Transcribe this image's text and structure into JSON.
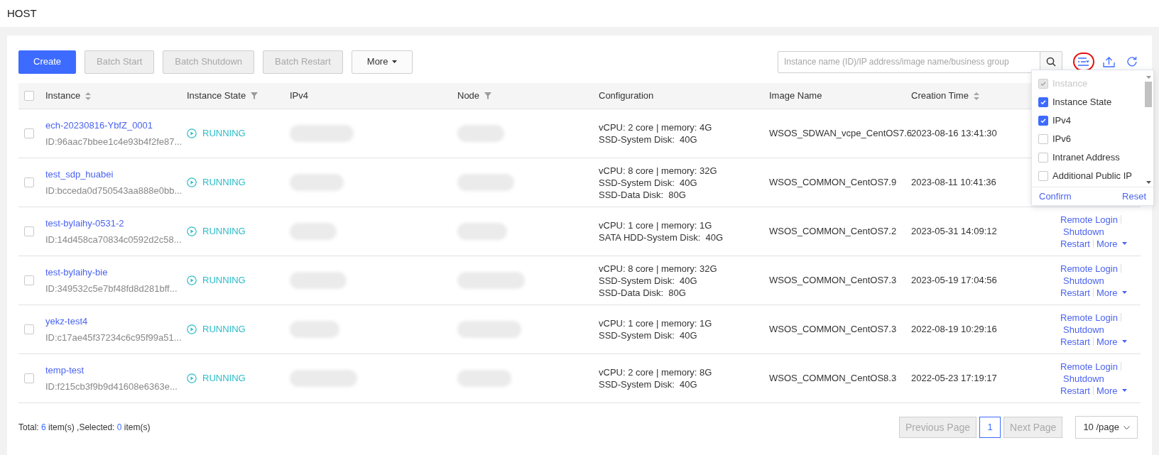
{
  "page_title": "HOST",
  "toolbar": [
    {
      "label": "Create",
      "kind": "primary"
    },
    {
      "label": "Batch Start",
      "kind": "disabled"
    },
    {
      "label": "Batch Shutdown",
      "kind": "disabled"
    },
    {
      "label": "Batch Restart",
      "kind": "disabled"
    },
    {
      "label": "More",
      "kind": "dropdown"
    }
  ],
  "search": {
    "placeholder": "Instance name (ID)/IP address/image name/business group"
  },
  "table": {
    "select_all_checked": false,
    "columns": [
      {
        "label": "Instance",
        "kind": "sort"
      },
      {
        "label": "Instance State",
        "kind": "filter"
      },
      {
        "label": "IPv4",
        "kind": "plain"
      },
      {
        "label": "Node",
        "kind": "filter"
      },
      {
        "label": "Configuration",
        "kind": "plain"
      },
      {
        "label": "Image Name",
        "kind": "plain"
      },
      {
        "label": "Creation Time",
        "kind": "sort"
      }
    ],
    "rows": [
      {
        "checked": false,
        "name": "ech-20230816-YbfZ_0001",
        "id": "ID:96aac7bbee1c4e93b4f2fe87...",
        "state": "RUNNING",
        "configuration": [
          "vCPU: 2 core | memory: 4G",
          "SSD-System Disk:  40G"
        ],
        "image": "WSOS_SDWAN_vcpe_CentOS7.6",
        "created": "2023-08-16 13:41:30"
      },
      {
        "checked": false,
        "name": "test_sdp_huabei",
        "id": "ID:bcceda0d750543aa888e0bb...",
        "state": "RUNNING",
        "configuration": [
          "vCPU: 8 core | memory: 32G",
          "SSD-System Disk:  40G",
          "SSD-Data Disk:  80G"
        ],
        "image": "WSOS_COMMON_CentOS7.9",
        "created": "2023-08-11 10:41:36"
      },
      {
        "checked": false,
        "name": "test-bylaihy-0531-2",
        "id": "ID:14d458ca70834c0592d2c58...",
        "state": "RUNNING",
        "configuration": [
          "vCPU: 1 core | memory: 1G",
          "SATA HDD-System Disk:  40G"
        ],
        "image": "WSOS_COMMON_CentOS7.2",
        "created": "2023-05-31 14:09:12",
        "actions": [
          "Remote Login",
          "Shutdown",
          "Restart",
          "More"
        ]
      },
      {
        "checked": false,
        "name": "test-bylaihy-bie",
        "id": "ID:349532c5e7bf48fd8d281bff...",
        "state": "RUNNING",
        "configuration": [
          "vCPU: 8 core | memory: 32G",
          "SSD-System Disk:  40G",
          "SSD-Data Disk:  80G"
        ],
        "image": "WSOS_COMMON_CentOS7.3",
        "created": "2023-05-19 17:04:56",
        "actions": [
          "Remote Login",
          "Shutdown",
          "Restart",
          "More"
        ]
      },
      {
        "checked": false,
        "name": "yekz-test4",
        "id": "ID:c17ae45f37234c6c95f99a51...",
        "state": "RUNNING",
        "configuration": [
          "vCPU: 1 core | memory: 1G",
          "SSD-System Disk:  40G"
        ],
        "image": "WSOS_COMMON_CentOS7.3",
        "created": "2022-08-19 10:29:16",
        "actions": [
          "Remote Login",
          "Shutdown",
          "Restart",
          "More"
        ]
      },
      {
        "checked": false,
        "name": "temp-test",
        "id": "ID:f215cb3f9b9d41608e6363e...",
        "state": "RUNNING",
        "configuration": [
          "vCPU: 2 core | memory: 8G",
          "SSD-System Disk:  40G"
        ],
        "image": "WSOS_COMMON_CentOS8.3",
        "created": "2022-05-23 17:19:17",
        "actions": [
          "Remote Login",
          "Shutdown",
          "Restart",
          "More"
        ]
      }
    ]
  },
  "column_picker": {
    "items": [
      {
        "label": "Instance",
        "checked": true,
        "disabled": true
      },
      {
        "label": "Instance State",
        "checked": true,
        "disabled": false
      },
      {
        "label": "IPv4",
        "checked": true,
        "disabled": false
      },
      {
        "label": "IPv6",
        "checked": false,
        "disabled": false
      },
      {
        "label": "Intranet Address",
        "checked": false,
        "disabled": false
      },
      {
        "label": "Additional Public IP",
        "checked": false,
        "disabled": false
      }
    ],
    "confirm": "Confirm",
    "reset": "Reset"
  },
  "footer": {
    "total_label": "Total:",
    "total": "6",
    "selected_label": "item(s) ,Selected:",
    "selected": "0",
    "unit": "item(s)"
  },
  "pagination": {
    "previous": "Previous Page",
    "pages": [
      {
        "label": "1",
        "selected": true
      }
    ],
    "next": "Next Page",
    "page_size": "10 /page"
  }
}
